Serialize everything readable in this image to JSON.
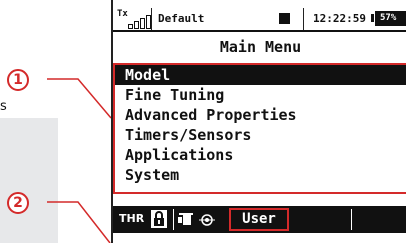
{
  "side_text": "s",
  "callouts": [
    "1",
    "2"
  ],
  "status_bar": {
    "tx_label": "Tx",
    "signal_icon": "signal-bars-icon",
    "model_name": "Default",
    "clock": "12:22:59",
    "battery": "57%"
  },
  "menu": {
    "title": "Main Menu",
    "items": [
      "Model",
      "Fine Tuning",
      "Advanced Properties",
      "Timers/Sensors",
      "Applications",
      "System"
    ],
    "selected_index": 0
  },
  "bottom_bar": {
    "thr_label": "THR",
    "lock_icon": "lock-icon",
    "trainer_icon": "trainer-icon",
    "softkey_label": "User"
  },
  "colors": {
    "callout": "#d42a2a",
    "lcd_ink": "#111111",
    "lcd_bg": "#ffffff"
  }
}
